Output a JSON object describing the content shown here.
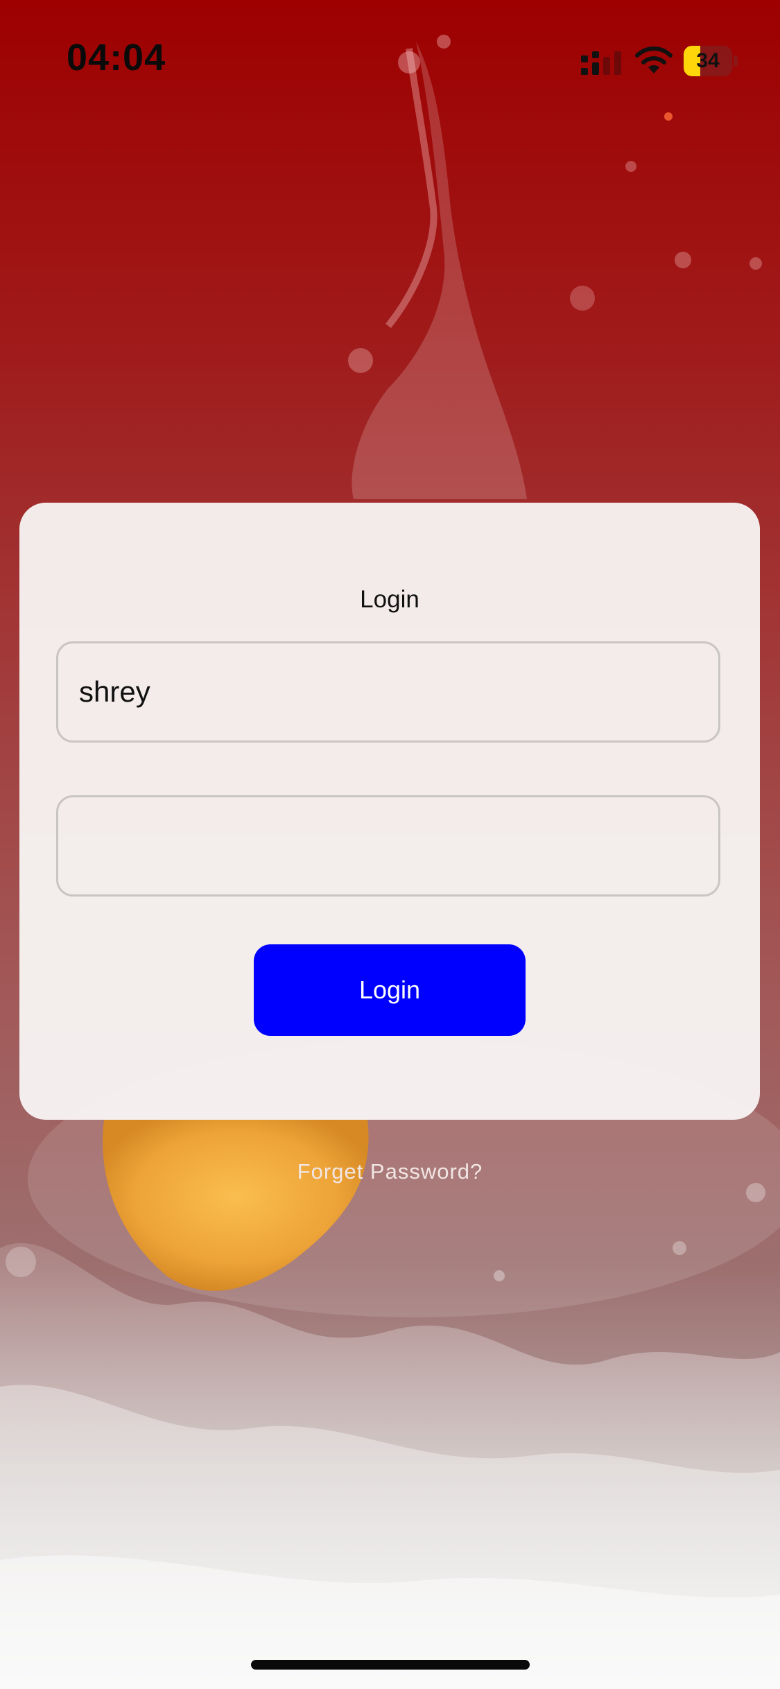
{
  "status_bar": {
    "time": "04:04",
    "battery_level": "34",
    "battery_fraction": 0.34,
    "battery_color": "#ffd60a",
    "icons": [
      "signal-icon",
      "wifi-icon",
      "battery-icon"
    ]
  },
  "login": {
    "title": "Login",
    "username_value": "shrey",
    "password_value": "",
    "button_label": "Login",
    "button_color": "#0000ff"
  },
  "forgot_password": {
    "label": "Forget Password?"
  }
}
